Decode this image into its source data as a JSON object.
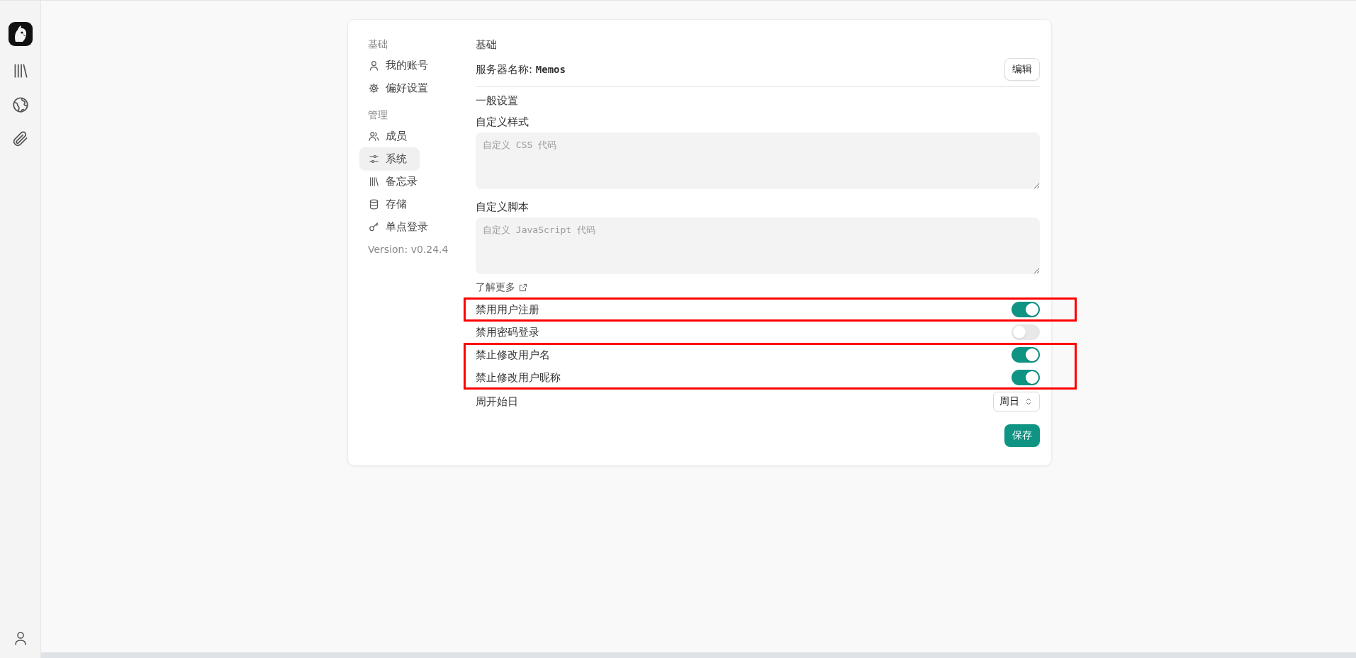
{
  "rail": {
    "items": [
      {
        "kind": "logo"
      },
      {
        "kind": "library"
      },
      {
        "kind": "explore"
      },
      {
        "kind": "attachments"
      }
    ],
    "footer": {
      "kind": "user"
    }
  },
  "nav": {
    "sections": [
      {
        "heading": "基础",
        "items": [
          {
            "label": "我的账号",
            "selected": false
          },
          {
            "label": "偏好设置",
            "selected": false
          }
        ]
      },
      {
        "heading": "管理",
        "items": [
          {
            "label": "成员",
            "selected": false
          },
          {
            "label": "系统",
            "selected": true
          },
          {
            "label": "备忘录",
            "selected": false
          },
          {
            "label": "存储",
            "selected": false
          },
          {
            "label": "单点登录",
            "selected": false
          }
        ]
      }
    ],
    "version": "Version: v0.24.4"
  },
  "panel": {
    "heading": "基础",
    "server_label": "服务器名称:",
    "server_name": "Memos",
    "edit_button": "编辑",
    "general_heading": "一般设置",
    "fields": [
      {
        "label": "自定义样式",
        "placeholder": "自定义 CSS 代码"
      },
      {
        "label": "自定义脚本",
        "placeholder": "自定义 JavaScript 代码"
      }
    ],
    "learn_more": "了解更多",
    "toggles": [
      {
        "label": "禁用用户注册",
        "on": true,
        "annotated": true
      },
      {
        "label": "禁用密码登录",
        "on": false,
        "annotated": false
      },
      {
        "label": "禁止修改用户名",
        "on": true,
        "annotated": true
      },
      {
        "label": "禁止修改用户昵称",
        "on": true,
        "annotated": true
      }
    ],
    "week_start": {
      "label": "周开始日",
      "value": "周日"
    },
    "save_button": "保存"
  }
}
